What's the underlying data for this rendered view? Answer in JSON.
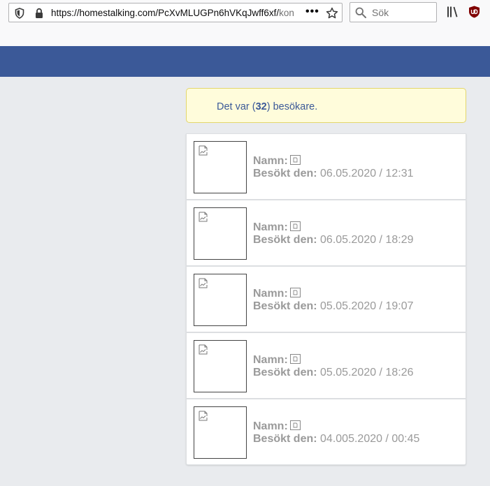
{
  "browser": {
    "url_main": "https://homestalking.com/PcXvMLUGPn6hVKqJwff6xf/",
    "url_tail": "kon",
    "page_actions_label": "•••",
    "search_placeholder": "Sök"
  },
  "notice": {
    "prefix": "Det var (",
    "count": "32",
    "suffix": ") besökare."
  },
  "labels": {
    "name": "Namn:",
    "visited": "Besökt den:"
  },
  "visitors": [
    {
      "date": "06.05.2020 / 12:31"
    },
    {
      "date": "06.05.2020 / 18:29"
    },
    {
      "date": "05.05.2020 / 19:07"
    },
    {
      "date": "05.05.2020 / 18:26"
    },
    {
      "date": "04.005.2020 / 00:45"
    }
  ],
  "colors": {
    "header": "#3b5998",
    "notice_bg": "#fffcdb",
    "notice_border": "#e3d66b",
    "notice_text": "#3b5998",
    "label_gray": "#9a9a9a",
    "page_bg": "#e9ebee"
  },
  "icons": {
    "urlbar_left": "shield-icon",
    "urlbar_secure": "lock-icon",
    "bookmark": "star-icon",
    "search": "search-icon",
    "library": "library-icon",
    "extension": "ublock-origin-icon",
    "avatar": "broken-image-icon",
    "name_placeholder": "broken-image-icon"
  }
}
